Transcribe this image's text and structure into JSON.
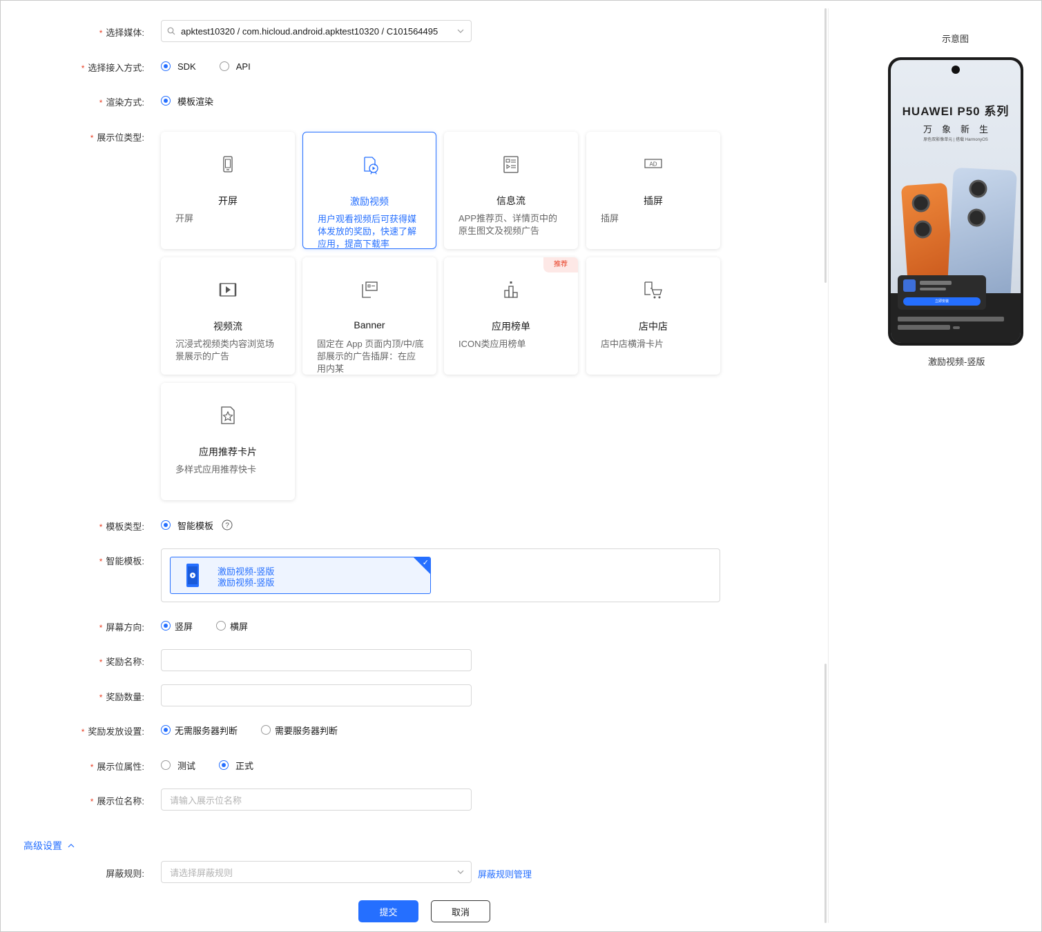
{
  "form": {
    "media": {
      "label": "选择媒体:",
      "value": "apktest10320 / com.hicloud.android.apktest10320 / C101564495"
    },
    "access": {
      "label": "选择接入方式:",
      "options": [
        "SDK",
        "API"
      ],
      "selected": "SDK"
    },
    "render": {
      "label": "渲染方式:",
      "options": [
        "模板渲染"
      ],
      "selected": "模板渲染"
    },
    "slot_type": {
      "label": "展示位类型:",
      "cards": [
        {
          "title": "开屏",
          "desc": "开屏",
          "icon": "phone-icon",
          "active": false
        },
        {
          "title": "激励视频",
          "desc": "用户观看视频后可获得媒体发放的奖励，快速了解应用，提高下载率",
          "icon": "reward-video-icon",
          "active": true
        },
        {
          "title": "信息流",
          "desc": "APP推荐页、详情页中的原生图文及视频广告",
          "icon": "feed-icon",
          "active": false
        },
        {
          "title": "插屏",
          "desc": "插屏",
          "icon": "ad-icon",
          "active": false
        },
        {
          "title": "视频流",
          "desc": "沉浸式视频类内容浏览场景展示的广告",
          "icon": "video-icon",
          "active": false
        },
        {
          "title": "Banner",
          "desc": "固定在 App 页面内顶/中/底部展示的广告插屏：在应用内某",
          "icon": "banner-icon",
          "active": false
        },
        {
          "title": "应用榜单",
          "desc": "ICON类应用榜单",
          "icon": "ranking-icon",
          "active": false,
          "badge": "推荐"
        },
        {
          "title": "店中店",
          "desc": "店中店横滑卡片",
          "icon": "cart-icon",
          "active": false
        },
        {
          "title": "应用推荐卡片",
          "desc": "多样式应用推荐快卡",
          "icon": "star-card-icon",
          "active": false
        }
      ]
    },
    "template_type": {
      "label": "模板类型:",
      "options": [
        "智能模板"
      ],
      "selected": "智能模板"
    },
    "smart_template": {
      "label": "智能模板:",
      "item_title": "激励视频-竖版",
      "item_sub": "激励视频-竖版"
    },
    "orientation": {
      "label": "屏幕方向:",
      "options": [
        "竖屏",
        "横屏"
      ],
      "selected": "竖屏"
    },
    "reward_name": {
      "label": "奖励名称:",
      "value": ""
    },
    "reward_amount": {
      "label": "奖励数量:",
      "value": ""
    },
    "reward_setting": {
      "label": "奖励发放设置:",
      "options": [
        "无需服务器判断",
        "需要服务器判断"
      ],
      "selected": "无需服务器判断"
    },
    "slot_attr": {
      "label": "展示位属性:",
      "options": [
        "测试",
        "正式"
      ],
      "selected": "正式"
    },
    "slot_name": {
      "label": "展示位名称:",
      "placeholder": "请输入展示位名称"
    },
    "advanced": {
      "label": "高级设置"
    },
    "block_rule": {
      "label": "屏蔽规则:",
      "placeholder": "请选择屏蔽规则",
      "manage_link": "屏蔽规则管理"
    },
    "submit": "提交",
    "cancel": "取消"
  },
  "preview": {
    "title": "示意图",
    "caption": "激励视频-竖版",
    "phone": {
      "brand": "HUAWEI P50 系列",
      "slogan": "万象新生",
      "sub": "原色双影像单元 | 搭载 HarmonyOS",
      "ad_button": "立即安装"
    }
  },
  "colors": {
    "accent": "#256fff",
    "required": "#e84026",
    "badge_bg": "#fde8e6"
  }
}
